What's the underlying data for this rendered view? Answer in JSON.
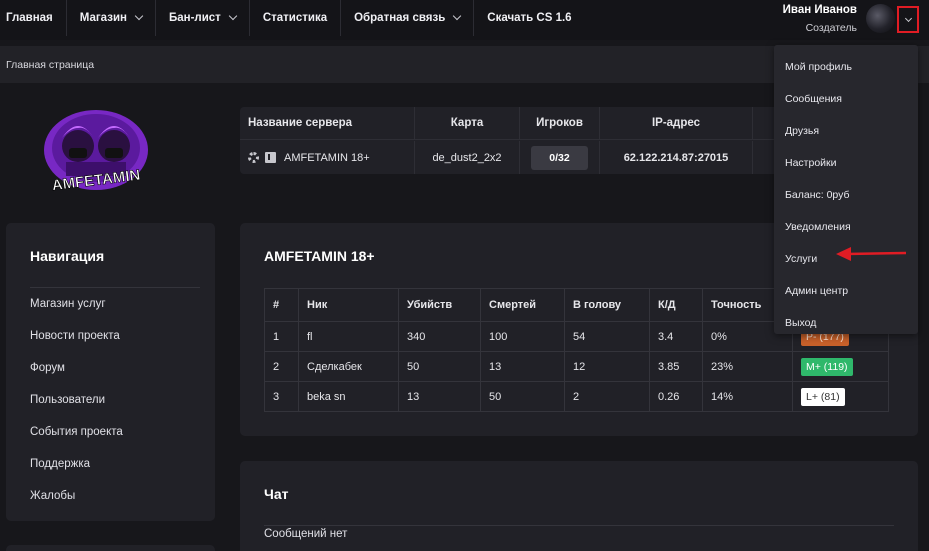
{
  "nav": {
    "items": [
      {
        "label": "Главная",
        "dropdown": false
      },
      {
        "label": "Магазин",
        "dropdown": true
      },
      {
        "label": "Бан-лист",
        "dropdown": true
      },
      {
        "label": "Статистика",
        "dropdown": false
      },
      {
        "label": "Обратная связь",
        "dropdown": true
      },
      {
        "label": "Скачать CS 1.6",
        "dropdown": false
      }
    ]
  },
  "user": {
    "name": "Иван Иванов",
    "role": "Создатель"
  },
  "breadcrumb": "Главная страница",
  "logo": {
    "text": "AMFETAMIN"
  },
  "server_table": {
    "headers": [
      "Название сервера",
      "Карта",
      "Игроков",
      "IP-адрес"
    ],
    "row": {
      "name": "AMFETAMIN 18+",
      "map": "de_dust2_2x2",
      "players": "0/32",
      "ip": "62.122.214.87:27015"
    }
  },
  "sidebar": {
    "title": "Навигация",
    "items": [
      "Магазин услуг",
      "Новости проекта",
      "Форум",
      "Пользователи",
      "События проекта",
      "Поддержка",
      "Жалобы"
    ]
  },
  "stats": {
    "title": "AMFETAMIN 18+",
    "headers": [
      "#",
      "Ник",
      "Убийств",
      "Смертей",
      "В голову",
      "К/Д",
      "Точность"
    ],
    "rows": [
      {
        "n": "1",
        "nick": "fl",
        "kills": "340",
        "deaths": "100",
        "hs": "54",
        "kd": "3.4",
        "acc": "0%",
        "rank": "P- (177)",
        "rank_color": "#c8612a",
        "rank_text": "#ffe6d6"
      },
      {
        "n": "2",
        "nick": "Сделкабек",
        "kills": "50",
        "deaths": "13",
        "hs": "12",
        "kd": "3.85",
        "acc": "23%",
        "rank": "M+ (119)",
        "rank_color": "#2fb86b",
        "rank_text": "#ffffff"
      },
      {
        "n": "3",
        "nick": "beka sn",
        "kills": "13",
        "deaths": "50",
        "hs": "2",
        "kd": "0.26",
        "acc": "14%",
        "rank": "L+ (81)",
        "rank_color": "#ffffff",
        "rank_text": "#333333"
      }
    ]
  },
  "chat": {
    "title": "Чат",
    "empty": "Сообщений нет"
  },
  "dropdown": {
    "items": [
      "Мой профиль",
      "Сообщения",
      "Друзья",
      "Настройки",
      "Баланс: 0руб",
      "Уведомления",
      "Услуги",
      "Админ центр",
      "Выход"
    ]
  },
  "colors": {
    "accent_red": "#e01c24",
    "bg": "#17171b",
    "card": "#212127"
  }
}
